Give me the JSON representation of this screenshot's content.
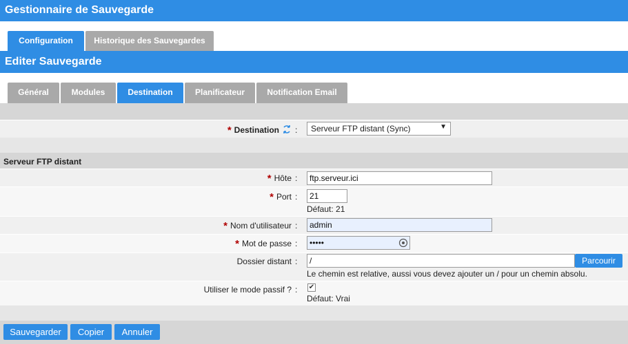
{
  "app": {
    "title": "Gestionnaire de Sauvegarde"
  },
  "main_tabs": [
    {
      "label": "Configuration",
      "active": true
    },
    {
      "label": "Historique des Sauvegardes",
      "active": false
    }
  ],
  "edit_title": "Editer Sauvegarde",
  "sub_tabs": [
    {
      "label": "Général"
    },
    {
      "label": "Modules"
    },
    {
      "label": "Destination",
      "active": true
    },
    {
      "label": "Planificateur"
    },
    {
      "label": "Notification Email"
    }
  ],
  "destination": {
    "label": "Destination",
    "value": "Serveur FTP distant (Sync)"
  },
  "section_title": "Serveur FTP distant",
  "fields": {
    "host": {
      "label": "Hôte",
      "value": "ftp.serveur.ici"
    },
    "port": {
      "label": "Port",
      "value": "21",
      "hint": "Défaut: 21"
    },
    "username": {
      "label": "Nom d'utilisateur",
      "value": "admin"
    },
    "password": {
      "label": "Mot de passe",
      "value": "•••••"
    },
    "remote_dir": {
      "label": "Dossier distant",
      "value": "/",
      "hint": "Le chemin est relative, aussi vous devez ajouter un / pour un chemin absolu.",
      "browse_label": "Parcourir"
    },
    "passive": {
      "label": "Utiliser le mode passif ?",
      "checked": true,
      "hint": "Défaut: Vrai"
    }
  },
  "colon": ":",
  "actions": {
    "save": "Sauvegarder",
    "copy": "Copier",
    "cancel": "Annuler"
  },
  "colors": {
    "accent": "#2f8de4",
    "required": "#b00000",
    "band": "#d6d6d6"
  }
}
